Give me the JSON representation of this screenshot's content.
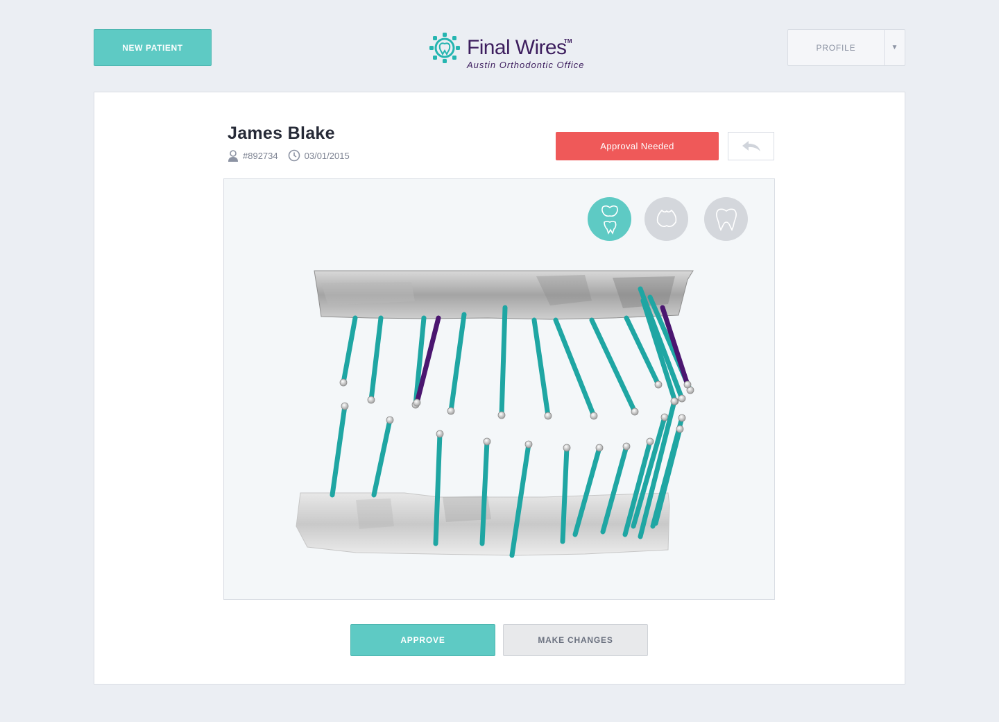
{
  "header": {
    "new_patient_label": "NEW PATIENT",
    "brand_name": "Final Wires",
    "brand_trademark": "TM",
    "office_name": "Austin Orthodontic Office",
    "profile_label": "PROFILE",
    "profile_caret": "▼"
  },
  "patient": {
    "name": "James Blake",
    "id": "#892734",
    "date": "03/01/2015",
    "status": "Approval Needed"
  },
  "viewer": {
    "toggles": [
      {
        "name": "both-arches",
        "icon": "upper-lower-teeth-icon",
        "active": true
      },
      {
        "name": "upper-arch",
        "icon": "molar-upper-icon",
        "active": false
      },
      {
        "name": "lower-arch",
        "icon": "molar-lower-icon",
        "active": false
      }
    ],
    "colors": {
      "wire": "#1fa6a3",
      "highlight_wire": "#4b1670",
      "scan": "#b9b9b9"
    }
  },
  "actions": {
    "approve_label": "APPROVE",
    "changes_label": "MAKE CHANGES"
  },
  "colors": {
    "accent": "#5ecac4",
    "alert": "#ef5959",
    "brand": "#3d1e5e"
  }
}
